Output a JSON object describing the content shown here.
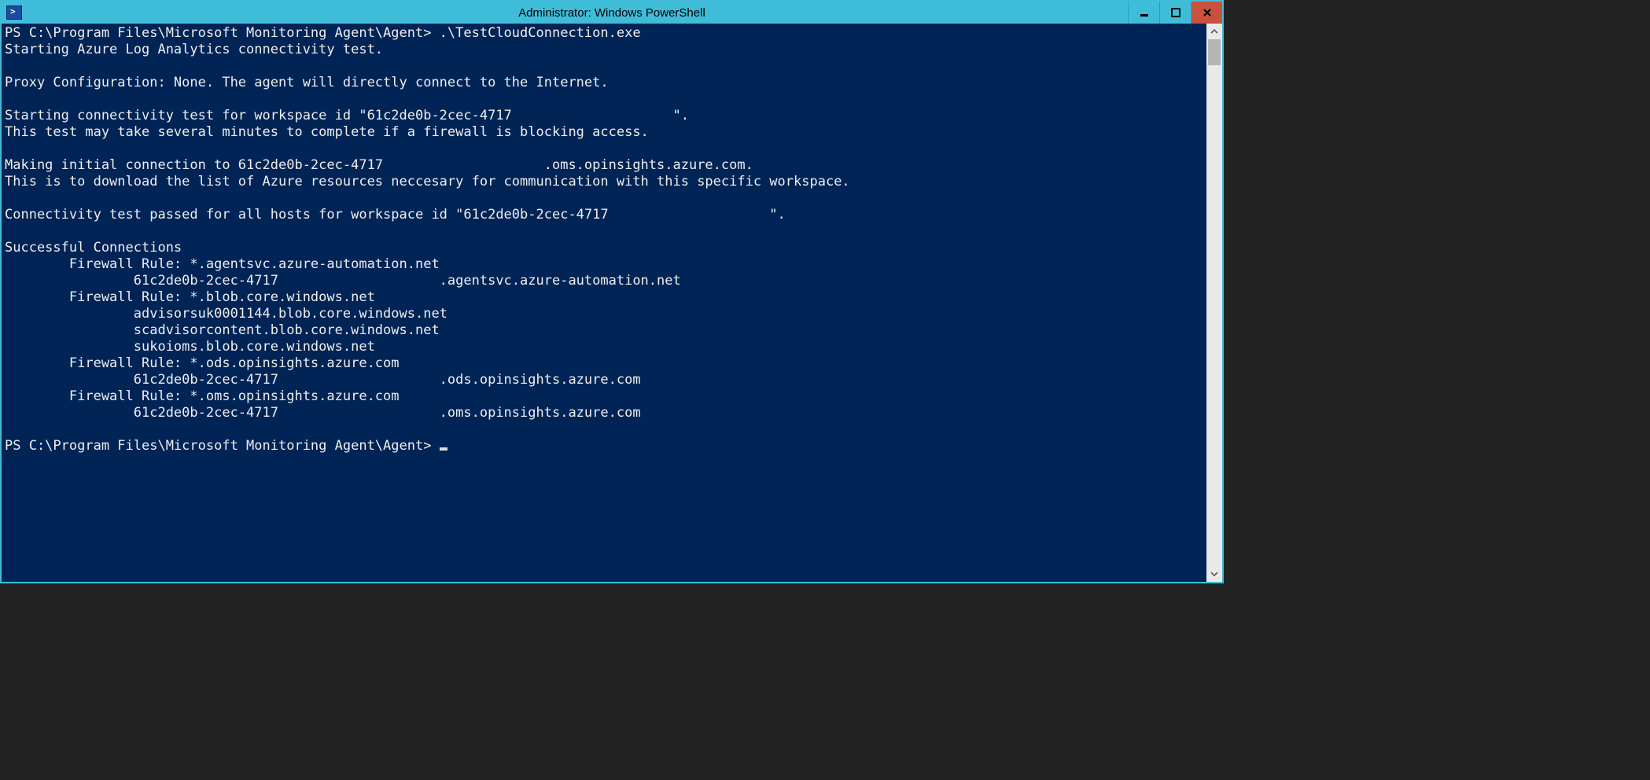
{
  "title": "Administrator: Windows PowerShell",
  "terminal": {
    "line01": "PS C:\\Program Files\\Microsoft Monitoring Agent\\Agent> .\\TestCloudConnection.exe",
    "line02": "Starting Azure Log Analytics connectivity test.",
    "line03": "",
    "line04": "Proxy Configuration: None. The agent will directly connect to the Internet.",
    "line05": "",
    "line06": "Starting connectivity test for workspace id \"61c2de0b-2cec-4717                    \".",
    "line07": "This test may take several minutes to complete if a firewall is blocking access.",
    "line08": "",
    "line09": "Making initial connection to 61c2de0b-2cec-4717                    .oms.opinsights.azure.com.",
    "line10": "This is to download the list of Azure resources neccesary for communication with this specific workspace.",
    "line11": "",
    "line12": "Connectivity test passed for all hosts for workspace id \"61c2de0b-2cec-4717                    \".",
    "line13": "",
    "line14": "Successful Connections",
    "line15": "        Firewall Rule: *.agentsvc.azure-automation.net",
    "line16": "                61c2de0b-2cec-4717                    .agentsvc.azure-automation.net",
    "line17": "        Firewall Rule: *.blob.core.windows.net",
    "line18": "                advisorsuk0001144.blob.core.windows.net",
    "line19": "                scadvisorcontent.blob.core.windows.net",
    "line20": "                sukoioms.blob.core.windows.net",
    "line21": "        Firewall Rule: *.ods.opinsights.azure.com",
    "line22": "                61c2de0b-2cec-4717                    .ods.opinsights.azure.com",
    "line23": "        Firewall Rule: *.oms.opinsights.azure.com",
    "line24": "                61c2de0b-2cec-4717                    .oms.opinsights.azure.com",
    "line25": "",
    "line26": "PS C:\\Program Files\\Microsoft Monitoring Agent\\Agent> "
  }
}
